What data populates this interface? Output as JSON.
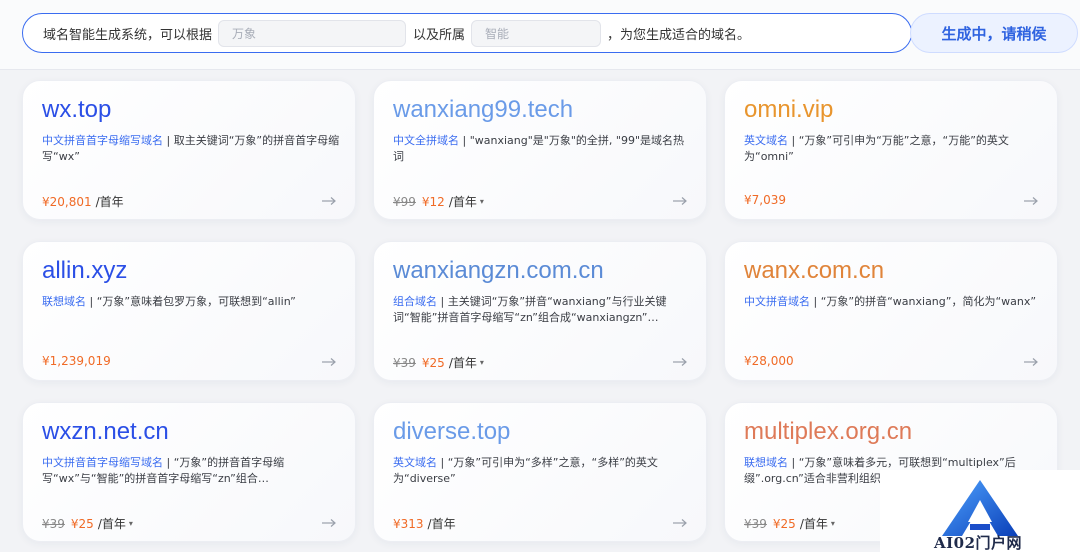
{
  "prompt": {
    "prefix": "域名智能生成系统，可以根据",
    "keyword_placeholder": "万象",
    "middle": "以及所属",
    "industry_placeholder": "智能",
    "suffix": "，为您生成适合的域名。"
  },
  "generate_button": "生成中，请稍侯",
  "cards": [
    {
      "domain": "wx.top",
      "color": "#2b4fe6",
      "tag": "中文拼音首字母缩写域名",
      "desc": " | 取主关键词“万象”的拼音首字母缩写“wx”",
      "old_price": "",
      "price": "¥20,801",
      "unit": "/首年",
      "has_dropdown": false
    },
    {
      "domain": "wanxiang99.tech",
      "color": "#6a9be8",
      "tag": "中文全拼域名",
      "desc": " | \"wanxiang\"是\"万象\"的全拼, \"99\"是域名热词",
      "old_price": "¥99",
      "price": "¥12",
      "unit": "/首年",
      "has_dropdown": true
    },
    {
      "domain": "omni.vip",
      "color": "#e8952e",
      "tag": "英文域名",
      "desc": " | “万象”可引申为“万能”之意，“万能”的英文为“omni”",
      "old_price": "",
      "price": "¥7,039",
      "unit": "",
      "has_dropdown": false
    },
    {
      "domain": "allin.xyz",
      "color": "#2b4fe6",
      "tag": "联想域名",
      "desc": " | “万象”意味着包罗万象，可联想到“allin”",
      "old_price": "",
      "price": "¥1,239,019",
      "unit": "",
      "has_dropdown": false
    },
    {
      "domain": "wanxiangzn.com.cn",
      "color": "#5b8bd6",
      "tag": "组合域名",
      "desc": " | 主关键词“万象”拼音“wanxiang”与行业关键词“智能”拼音首字母缩写“zn”组合成“wanxiangzn”…",
      "old_price": "¥39",
      "price": "¥25",
      "unit": "/首年",
      "has_dropdown": true
    },
    {
      "domain": "wanx.com.cn",
      "color": "#e0843a",
      "tag": "中文拼音域名",
      "desc": " | “万象”的拼音“wanxiang”，简化为“wanx”",
      "old_price": "",
      "price": "¥28,000",
      "unit": "",
      "has_dropdown": false
    },
    {
      "domain": "wxzn.net.cn",
      "color": "#2b4fe6",
      "tag": "中文拼音首字母缩写域名",
      "desc": " | “万象”的拼音首字母缩写“wx”与“智能”的拼音首字母缩写“zn”组合…",
      "old_price": "¥39",
      "price": "¥25",
      "unit": "/首年",
      "has_dropdown": true
    },
    {
      "domain": "diverse.top",
      "color": "#6a9be8",
      "tag": "英文域名",
      "desc": " | “万象”可引申为“多样”之意，“多样”的英文为“diverse”",
      "old_price": "",
      "price": "¥313",
      "unit": "/首年",
      "has_dropdown": false
    },
    {
      "domain": "multiplex.org.cn",
      "color": "#de7a58",
      "tag": "联想域名",
      "desc": " | “万象”意味着多元，可联想到“multiplex”后缀”.org.cn”适合非营利组织",
      "old_price": "¥39",
      "price": "¥25",
      "unit": "/首年",
      "has_dropdown": true
    }
  ],
  "watermark": {
    "text": "AI02门户网",
    "logo": "a-logo-icon"
  }
}
